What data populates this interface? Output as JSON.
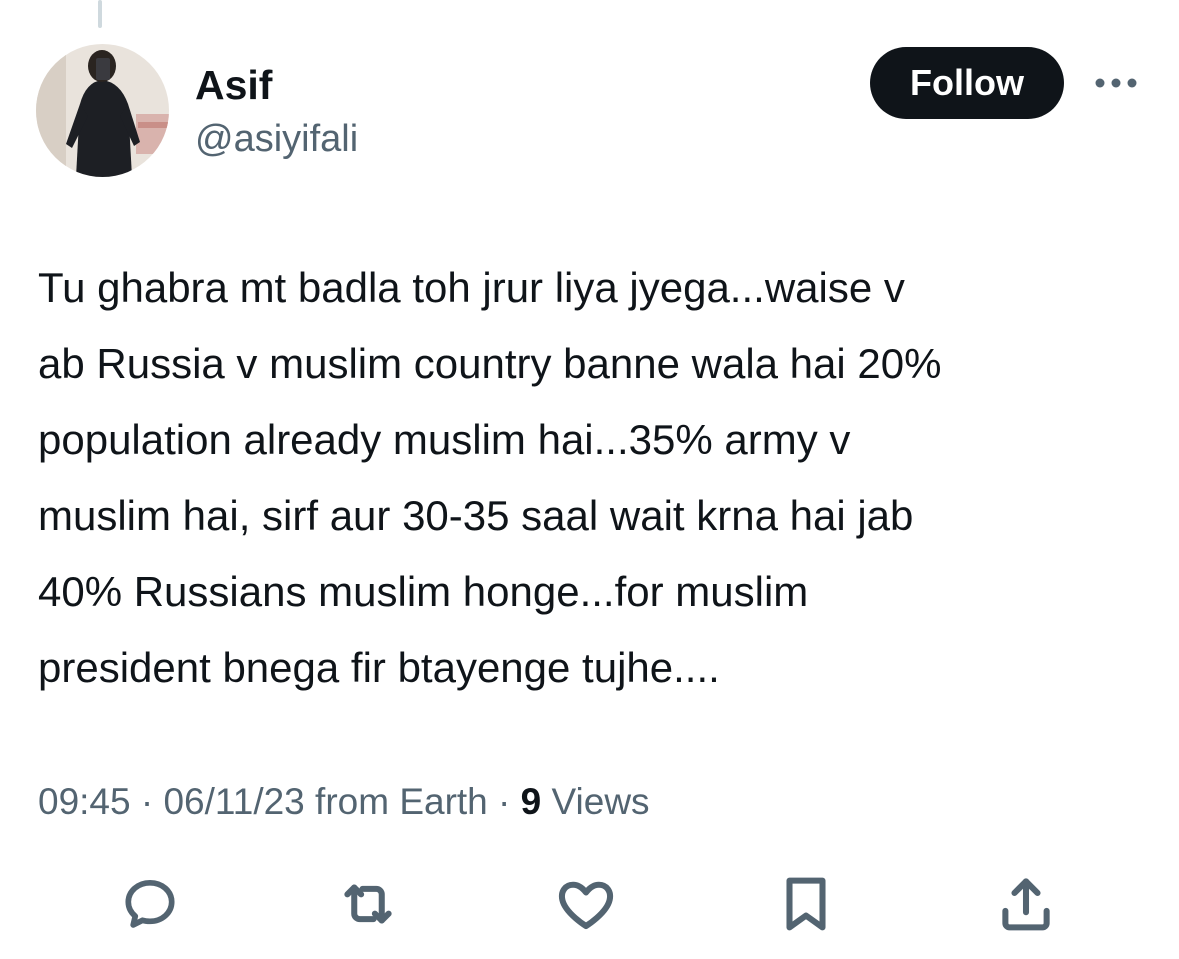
{
  "author": {
    "display_name": "Asif",
    "handle": "@asiyifali"
  },
  "header": {
    "follow_label": "Follow"
  },
  "tweet": {
    "text": "Tu ghabra mt badla toh jrur liya jyega...waise v\nab Russia v muslim country banne wala hai 20%\npopulation already muslim hai...35% army v\nmuslim hai, sirf aur 30-35 saal wait krna hai jab\n40% Russians muslim honge...for muslim\npresident bnega fir btayenge tujhe...."
  },
  "meta": {
    "time": "09:45",
    "separator": " · ",
    "date_source": "06/11/23 from Earth",
    "views_count": "9",
    "views_label": " Views"
  },
  "actions": {
    "reply_icon": "reply-icon",
    "retweet_icon": "retweet-icon",
    "like_icon": "heart-icon",
    "bookmark_icon": "bookmark-icon",
    "share_icon": "share-icon"
  },
  "colors": {
    "text_primary": "#0f1419",
    "text_secondary": "#536471",
    "follow_bg": "#0f1419",
    "follow_text": "#ffffff",
    "thread_line": "#cfd9de"
  }
}
